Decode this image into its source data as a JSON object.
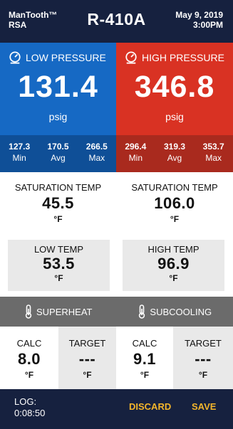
{
  "header": {
    "brand_line1": "ManTooth™",
    "brand_line2": "RSA",
    "refrigerant": "R-410A",
    "date": "May 9, 2019",
    "time": "3:00PM"
  },
  "low": {
    "title": "LOW PRESSURE",
    "value": "131.4",
    "unit": "psig",
    "stats": [
      {
        "value": "127.3",
        "label": "Min"
      },
      {
        "value": "170.5",
        "label": "Avg"
      },
      {
        "value": "266.5",
        "label": "Max"
      }
    ],
    "color": "#1669c4"
  },
  "high": {
    "title": "HIGH PRESSURE",
    "value": "346.8",
    "unit": "psig",
    "stats": [
      {
        "value": "296.4",
        "label": "Min"
      },
      {
        "value": "319.3",
        "label": "Avg"
      },
      {
        "value": "353.7",
        "label": "Max"
      }
    ],
    "color": "#d93223"
  },
  "saturation": {
    "left": {
      "title": "SATURATION TEMP",
      "value": "45.5",
      "unit": "°F"
    },
    "right": {
      "title": "SATURATION TEMP",
      "value": "106.0",
      "unit": "°F"
    }
  },
  "temps": {
    "low": {
      "title": "LOW TEMP",
      "value": "53.5",
      "unit": "°F"
    },
    "high": {
      "title": "HIGH TEMP",
      "value": "96.9",
      "unit": "°F"
    }
  },
  "sections": {
    "superheat": "SUPERHEAT",
    "subcooling": "SUBCOOLING"
  },
  "superheat": {
    "calc": {
      "title": "CALC",
      "value": "8.0",
      "unit": "°F"
    },
    "target": {
      "title": "TARGET",
      "value": "---",
      "unit": "°F"
    }
  },
  "subcooling": {
    "calc": {
      "title": "CALC",
      "value": "9.1",
      "unit": "°F"
    },
    "target": {
      "title": "TARGET",
      "value": "---",
      "unit": "°F"
    }
  },
  "footer": {
    "log_label": "LOG:",
    "log_time": "0:08:50",
    "discard": "DISCARD",
    "save": "SAVE",
    "accent": "#f3b52b"
  },
  "icons": {
    "pressure": "gauge-icon",
    "section": "thermometer-icon"
  }
}
